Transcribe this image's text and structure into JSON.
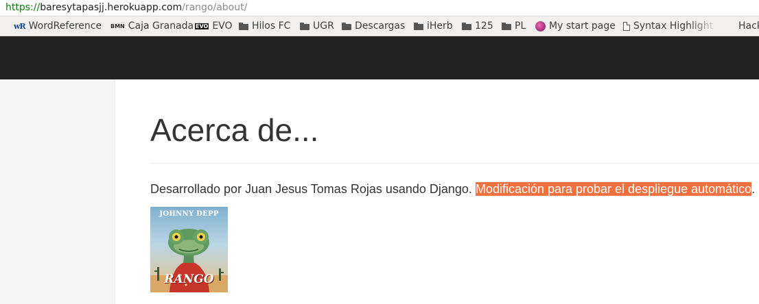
{
  "browser": {
    "url": {
      "scheme": "https",
      "separator": "://",
      "host": "baresytapasjj.herokuapp.com",
      "path": "/rango/about/"
    },
    "bookmarks": [
      {
        "label": "WordReference",
        "icon": "wordreference-icon"
      },
      {
        "label": "Caja Granada",
        "icon": "bmn-icon"
      },
      {
        "label": "EVO",
        "icon": "evo-icon"
      },
      {
        "label": "Hilos FC",
        "icon": "folder-icon"
      },
      {
        "label": "UGR",
        "icon": "folder-icon"
      },
      {
        "label": "Descargas",
        "icon": "folder-icon"
      },
      {
        "label": "iHerb",
        "icon": "folder-icon"
      },
      {
        "label": "125",
        "icon": "folder-icon"
      },
      {
        "label": "PL",
        "icon": "folder-icon"
      },
      {
        "label": "My start page",
        "icon": "start-page-icon"
      },
      {
        "label": "Syntax Highlight",
        "icon": "document-icon"
      },
      {
        "label": "Hack",
        "icon": "none"
      }
    ],
    "icon_text": {
      "wordreference": "wR",
      "bmn": "BMN",
      "evo": "EVO"
    }
  },
  "page": {
    "title": "Acerca de...",
    "description": "Desarrollado por Juan Jesus Tomas Rojas usando Django. ",
    "highlight": "Modificación para probar el despliegue automático",
    "trailing": ".",
    "poster": {
      "credit": "JOHNNY DEPP",
      "title": "RANGO"
    }
  },
  "colors": {
    "navbar": "#222222",
    "highlight": "#f07040",
    "sidebar": "#f5f5f5",
    "url_secure": "#0a7a0a"
  }
}
